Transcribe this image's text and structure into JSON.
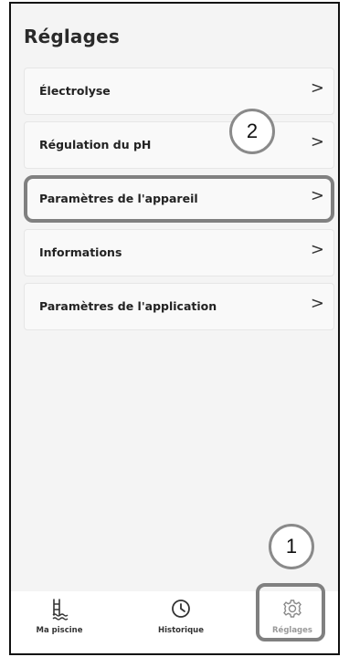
{
  "header": {
    "title": "Réglages"
  },
  "menu": {
    "items": [
      {
        "label": "Électrolyse",
        "chevron": ">"
      },
      {
        "label": "Régulation du pH",
        "chevron": ">"
      },
      {
        "label": "Paramètres de l'appareil",
        "chevron": ">"
      },
      {
        "label": "Informations",
        "chevron": ">"
      },
      {
        "label": "Paramètres de l'application",
        "chevron": ">"
      }
    ]
  },
  "callouts": {
    "step1": "1",
    "step2": "2"
  },
  "tabbar": {
    "items": [
      {
        "label": "Ma piscine",
        "icon": "pool-ladder-icon"
      },
      {
        "label": "Historique",
        "icon": "clock-icon"
      },
      {
        "label": "Réglages",
        "icon": "gear-icon"
      }
    ]
  },
  "colors": {
    "highlight_border": "#808080",
    "background": "#f4f4f4",
    "text": "#222222"
  }
}
